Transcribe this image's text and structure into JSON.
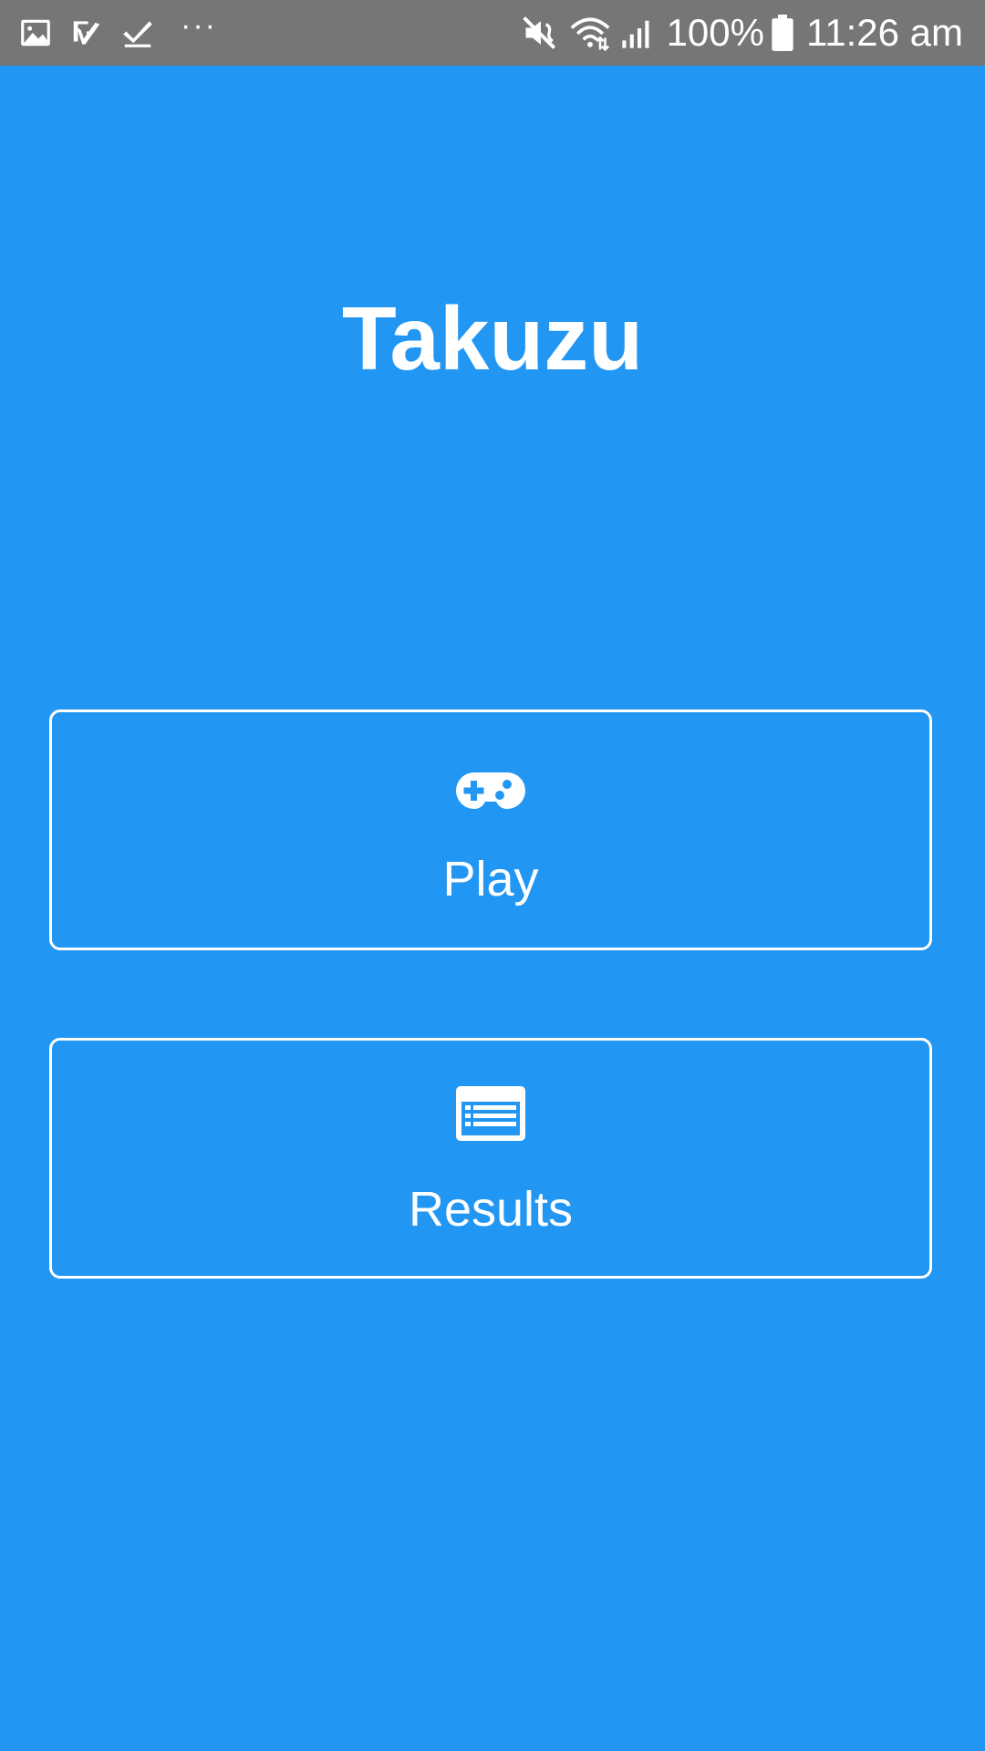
{
  "status_bar": {
    "battery_percent": "100%",
    "time": "11:26 am",
    "more_indicator": "···"
  },
  "app": {
    "title": "Takuzu"
  },
  "menu": {
    "play_label": "Play",
    "results_label": "Results"
  },
  "colors": {
    "background": "#2196F3",
    "status_bar": "#767676",
    "foreground": "#FFFFFF"
  }
}
